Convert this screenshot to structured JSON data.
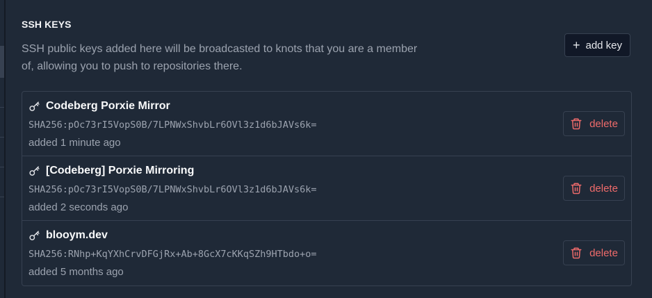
{
  "section": {
    "title": "SSH KEYS",
    "description": "SSH public keys added here will be broadcasted to knots that you are a member of, allowing you to push to repositories there.",
    "add_button_label": "add key",
    "add_button_icon": "plus-icon"
  },
  "keys": [
    {
      "name": "Codeberg Porxie Mirror",
      "fingerprint": "SHA256:pOc73rI5VopS0B/7LPNWxShvbLr6OVl3z1d6bJAVs6k=",
      "added": "added 1 minute ago",
      "delete_label": "delete"
    },
    {
      "name": "[Codeberg] Porxie Mirroring",
      "fingerprint": "SHA256:pOc73rI5VopS0B/7LPNWxShvbLr6OVl3z1d6bJAVs6k=",
      "added": "added 2 seconds ago",
      "delete_label": "delete"
    },
    {
      "name": "blooym.dev",
      "fingerprint": "SHA256:RNhp+KqYXhCrvDFGjRx+Ab+8GcX7cKKqSZh9HTbdo+o=",
      "added": "added 5 months ago",
      "delete_label": "delete"
    }
  ],
  "colors": {
    "background": "#1f2937",
    "border": "#374151",
    "danger": "#ef6b6b",
    "muted_text": "#9ca3af",
    "heading_text": "#f9fafb"
  }
}
